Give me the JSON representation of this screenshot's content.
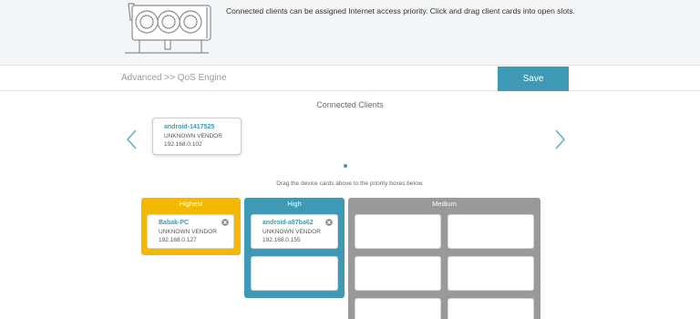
{
  "banner": {
    "text": "Connected clients can be assigned Internet access priority. Click and drag client cards into open slots.",
    "illustration_icon": "router-illustration-icon"
  },
  "breadcrumb": "Advanced >> QoS Engine",
  "toolbar": {
    "save_label": "Save"
  },
  "colors": {
    "accent": "#3e99b5",
    "highest": "#f5b800",
    "high": "#3e99b5",
    "medium": "#999999"
  },
  "connected_clients": {
    "title": "Connected Clients",
    "cards": [
      {
        "name": "android-1417525",
        "vendor": "UNKNOWN VENDOR",
        "ip": "192.168.0.102"
      }
    ],
    "left_icon": "chevron-left-icon",
    "right_icon": "chevron-right-icon"
  },
  "instruction": "Drag the device cards above to the priority boxes below.",
  "priority": {
    "highest": {
      "label": "Highest",
      "cards": [
        {
          "name": "Babak-PC",
          "vendor": "UNKNOWN VENDOR",
          "ip": "192.168.0.127"
        }
      ]
    },
    "high": {
      "label": "High",
      "cards": [
        {
          "name": "android-a87ba62",
          "vendor": "UNKNOWN VENDOR",
          "ip": "192.168.0.155"
        }
      ]
    },
    "medium": {
      "label": "Medium"
    }
  }
}
